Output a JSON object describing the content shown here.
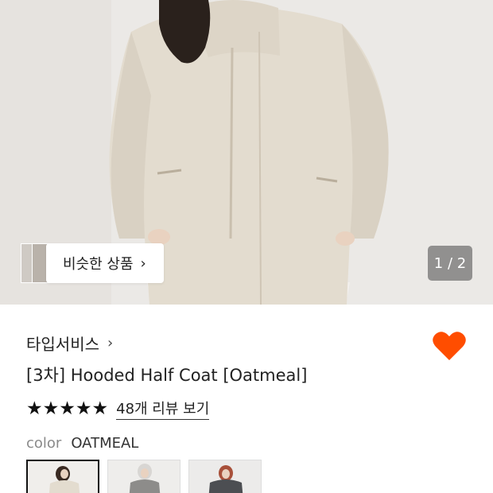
{
  "gallery": {
    "similar_label": "비슷한 상품",
    "similar_chevron": "›",
    "page_indicator": "1 / 2"
  },
  "product": {
    "brand": "타입서비스",
    "brand_chevron": "›",
    "title": "[3차] Hooded Half Coat [Oatmeal]",
    "rating_stars": 5,
    "review_link": "48개 리뷰 보기",
    "wishlist_active": true,
    "wishlist_color": "#ff4d00"
  },
  "options": {
    "color_label": "color",
    "color_value": "OATMEAL",
    "swatches": [
      "oatmeal",
      "grey",
      "charcoal"
    ],
    "selected_index": 0
  },
  "colors": {
    "coat": "#e3dccf",
    "heart": "#ff4d00",
    "star": "#111111"
  }
}
